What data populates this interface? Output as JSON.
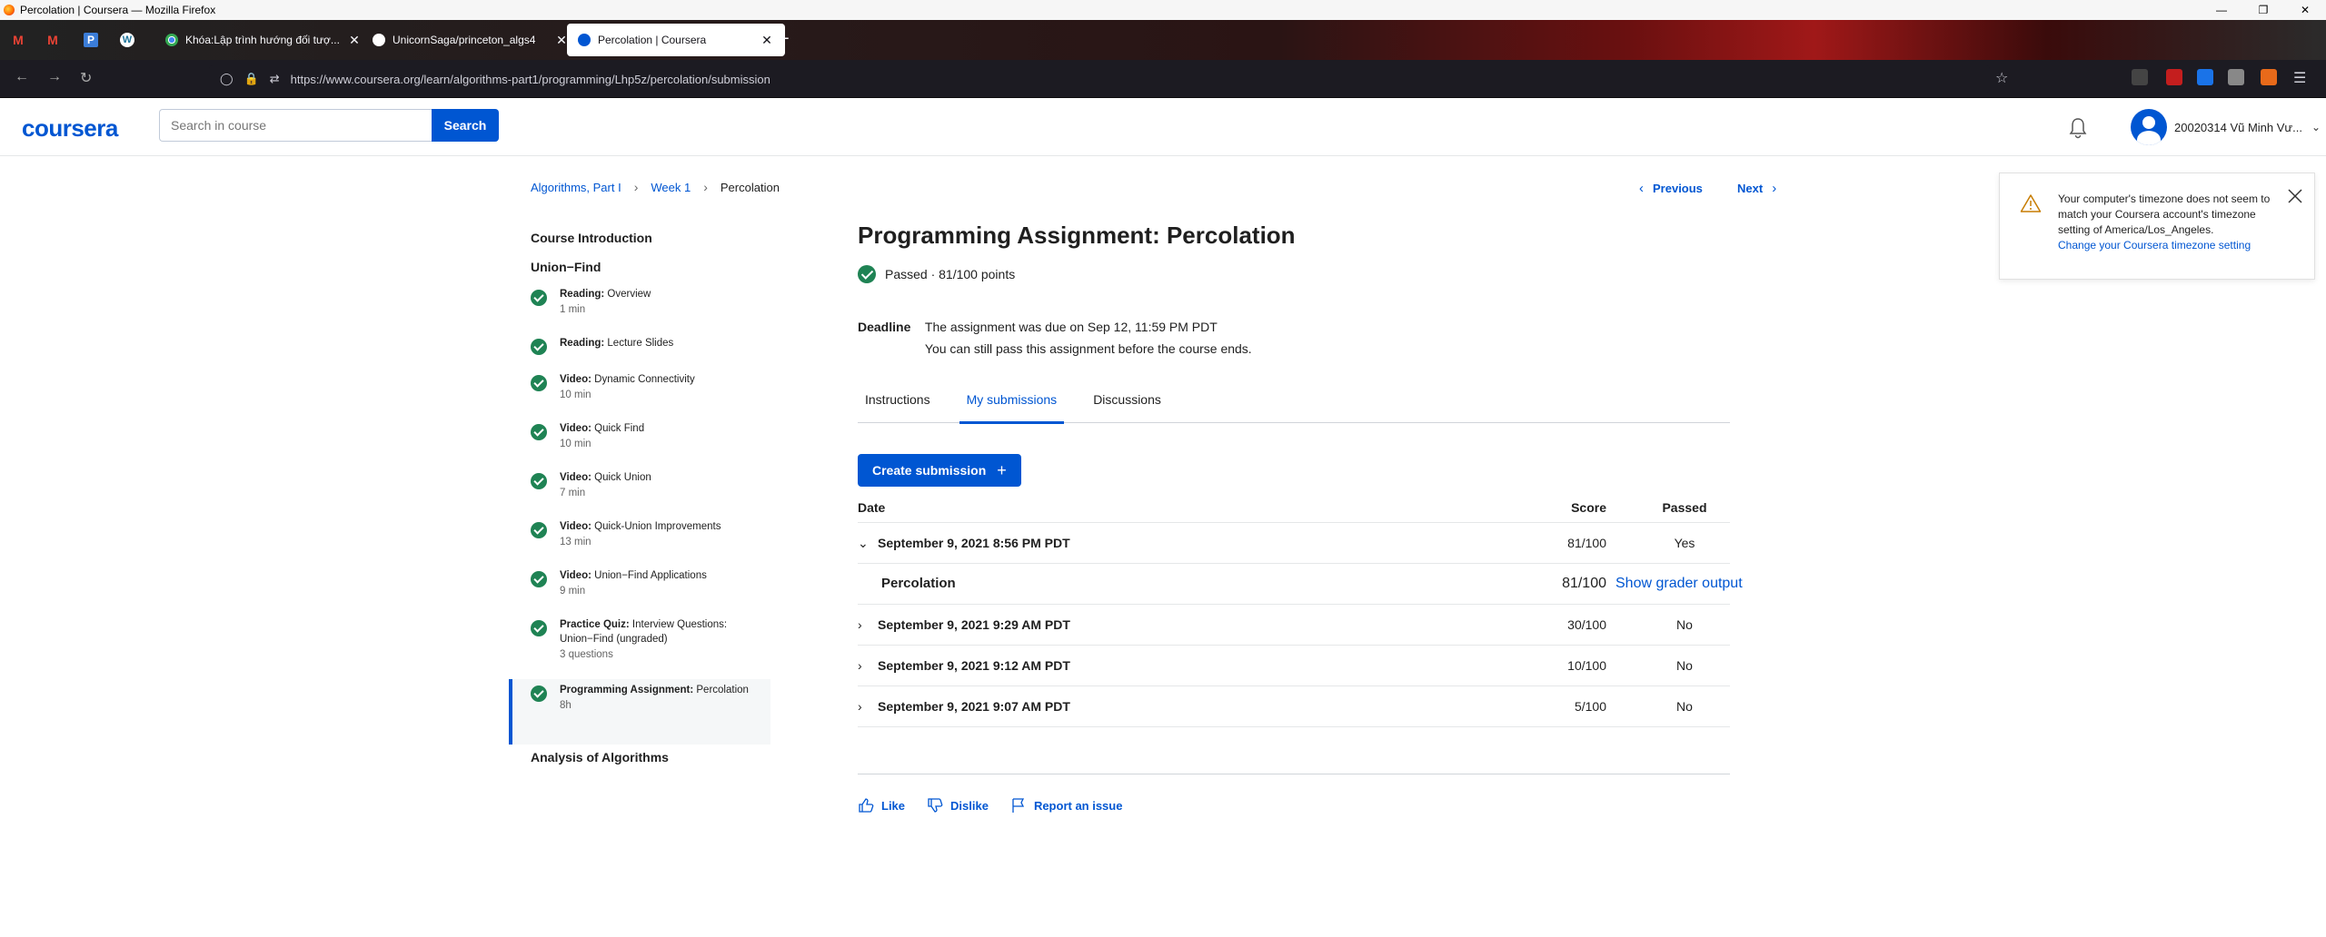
{
  "browser": {
    "window_title": "Percolation | Coursera — Mozilla Firefox",
    "tabs": [
      {
        "label": "Khóa:Lập trình hướng đối tượ..."
      },
      {
        "label": "UnicornSaga/princeton_algs4"
      },
      {
        "label": "Percolation | Coursera"
      }
    ],
    "url": "https://www.coursera.org/learn/algorithms-part1/programming/Lhp5z/percolation/submission"
  },
  "header": {
    "logo": "coursera",
    "search_placeholder": "Search in course",
    "search_button": "Search",
    "user_name": "20020314 Vũ Minh Vư..."
  },
  "breadcrumb": {
    "items": [
      "Algorithms, Part I",
      "Week 1",
      "Percolation"
    ],
    "previous": "Previous",
    "next": "Next"
  },
  "sidebar": {
    "sections": [
      "Course Introduction",
      "Union−Find",
      "Analysis of Algorithms"
    ],
    "items": [
      {
        "type": "Reading:",
        "title": "Overview",
        "duration": "1 min"
      },
      {
        "type": "Reading:",
        "title": "Lecture Slides",
        "duration": ""
      },
      {
        "type": "Video:",
        "title": "Dynamic Connectivity",
        "duration": "10 min"
      },
      {
        "type": "Video:",
        "title": "Quick Find",
        "duration": "10 min"
      },
      {
        "type": "Video:",
        "title": "Quick Union",
        "duration": "7 min"
      },
      {
        "type": "Video:",
        "title": "Quick-Union Improvements",
        "duration": "13 min"
      },
      {
        "type": "Video:",
        "title": "Union−Find Applications",
        "duration": "9 min"
      },
      {
        "type": "Practice Quiz:",
        "title": "Interview Questions: Union−Find (ungraded)",
        "duration": "3 questions"
      },
      {
        "type": "Programming Assignment:",
        "title": "Percolation",
        "duration": "8h"
      }
    ]
  },
  "main": {
    "title": "Programming Assignment: Percolation",
    "status": "Passed · 81/100 points",
    "deadline_label": "Deadline",
    "deadline_line1": "The assignment was due on Sep 12, 11:59 PM PDT",
    "deadline_line2": "You can still pass this assignment before the course ends.",
    "tabs": [
      "Instructions",
      "My submissions",
      "Discussions"
    ],
    "create_button": "Create submission",
    "table_headers": {
      "date": "Date",
      "score": "Score",
      "passed": "Passed"
    },
    "submissions": [
      {
        "date": "September 9, 2021 8:56 PM PDT",
        "score": "81/100",
        "passed": "Yes"
      },
      {
        "date": "September 9, 2021 9:29 AM PDT",
        "score": "30/100",
        "passed": "No"
      },
      {
        "date": "September 9, 2021 9:12 AM PDT",
        "score": "10/100",
        "passed": "No"
      },
      {
        "date": "September 9, 2021 9:07 AM PDT",
        "score": "5/100",
        "passed": "No"
      }
    ],
    "expanded": {
      "name": "Percolation",
      "score": "81/100",
      "link": "Show grader output"
    },
    "feedback": {
      "like": "Like",
      "dislike": "Dislike",
      "report": "Report an issue"
    }
  },
  "toast": {
    "message": "Your computer's timezone does not seem to match your Coursera account's timezone setting of America/Los_Angeles.",
    "link": "Change your Coursera timezone setting"
  },
  "colors": {
    "brand": "#0056d2",
    "success": "#1f8354"
  }
}
